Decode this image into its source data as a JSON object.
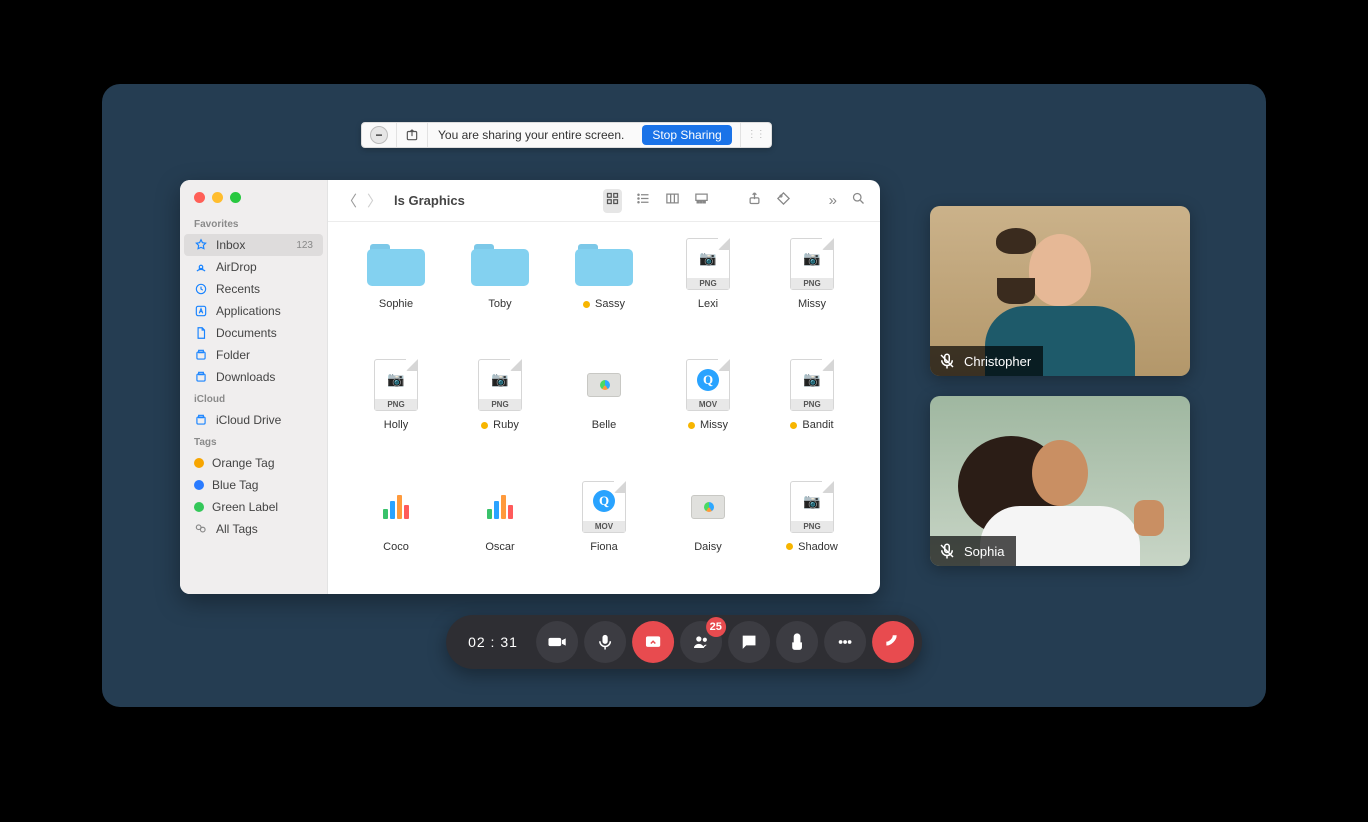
{
  "share_toolbar": {
    "message": "You are sharing your entire screen.",
    "stop_label": "Stop Sharing"
  },
  "finder": {
    "title": "ls Graphics",
    "sidebar": {
      "headings": {
        "favorites": "Favorites",
        "icloud": "iCloud",
        "tags": "Tags"
      },
      "favorites": [
        {
          "label": "Inbox",
          "icon": "star",
          "selected": true,
          "badge": "123"
        },
        {
          "label": "AirDrop",
          "icon": "airdrop"
        },
        {
          "label": "Recents",
          "icon": "clock"
        },
        {
          "label": "Applications",
          "icon": "app"
        },
        {
          "label": "Documents",
          "icon": "doc"
        },
        {
          "label": "Folder",
          "icon": "disk"
        },
        {
          "label": "Downloads",
          "icon": "disk"
        }
      ],
      "icloud": [
        {
          "label": "iCloud Drive",
          "icon": "disk"
        }
      ],
      "tags": [
        {
          "label": "Orange Tag",
          "color": "#f7a500"
        },
        {
          "label": "Blue Tag",
          "color": "#2a7bff"
        },
        {
          "label": "Green Label",
          "color": "#34c759"
        },
        {
          "label": "All Tags",
          "all": true
        }
      ]
    },
    "items": [
      {
        "name": "Sophie",
        "kind": "folder"
      },
      {
        "name": "Toby",
        "kind": "folder"
      },
      {
        "name": "Sassy",
        "kind": "folder",
        "tagged": true
      },
      {
        "name": "Lexi",
        "kind": "png-camera"
      },
      {
        "name": "Missy",
        "kind": "png-camera"
      },
      {
        "name": "Holly",
        "kind": "png-camera"
      },
      {
        "name": "Ruby",
        "kind": "png-camera",
        "tagged": true
      },
      {
        "name": "Belle",
        "kind": "keynote"
      },
      {
        "name": "Missy",
        "kind": "mov",
        "tagged": true
      },
      {
        "name": "Bandit",
        "kind": "png-camera",
        "tagged": true
      },
      {
        "name": "Coco",
        "kind": "numbers-bars"
      },
      {
        "name": "Oscar",
        "kind": "numbers-bars"
      },
      {
        "name": "Fiona",
        "kind": "mov"
      },
      {
        "name": "Daisy",
        "kind": "keynote"
      },
      {
        "name": "Shadow",
        "kind": "png-camera",
        "tagged": true
      }
    ]
  },
  "participants": [
    {
      "name": "Christopher",
      "muted": true
    },
    {
      "name": "Sophia",
      "muted": true
    }
  ],
  "controls": {
    "timer": "02 : 31",
    "participants_badge": "25"
  }
}
